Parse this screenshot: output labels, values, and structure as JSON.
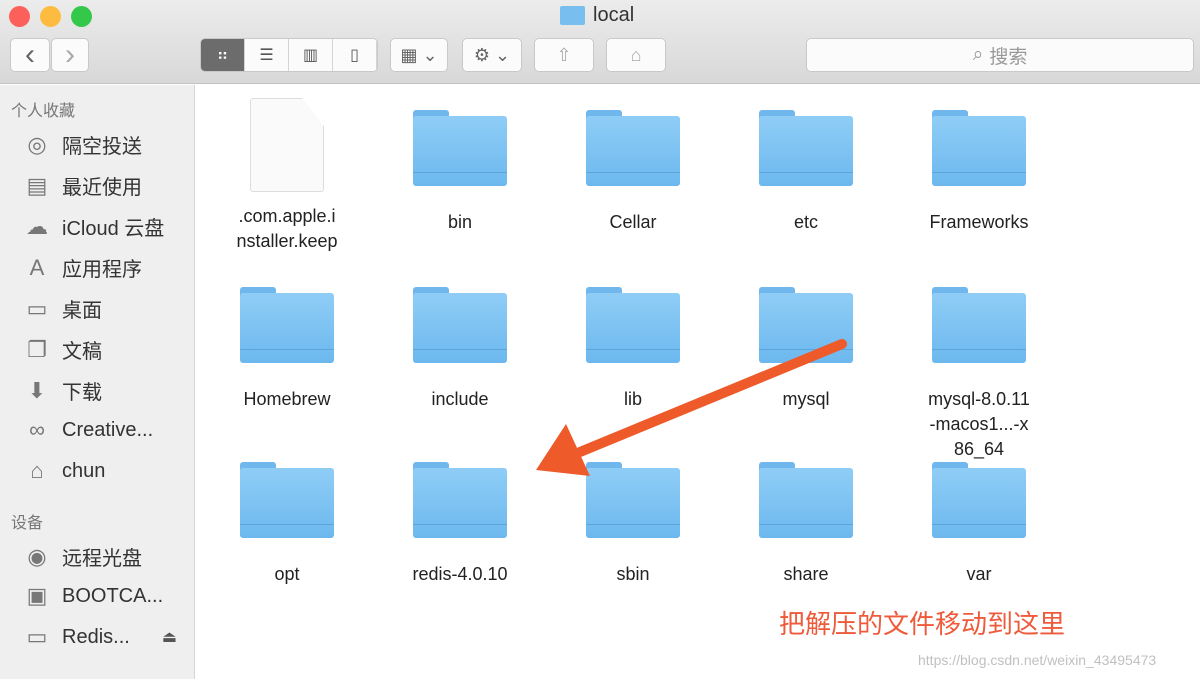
{
  "window": {
    "title": "local",
    "folder_icon": "folder-icon"
  },
  "toolbar": {
    "back": "‹",
    "forward": "›",
    "search_placeholder": "搜索"
  },
  "sidebar": {
    "favorites_header": "个人收藏",
    "favorites": [
      {
        "label": "隔空投送",
        "icon": "airdrop-icon",
        "glyph": "◎"
      },
      {
        "label": "最近使用",
        "icon": "recents-icon",
        "glyph": "▤"
      },
      {
        "label": "iCloud 云盘",
        "icon": "cloud-icon",
        "glyph": "☁"
      },
      {
        "label": "应用程序",
        "icon": "applications-icon",
        "glyph": "A"
      },
      {
        "label": "桌面",
        "icon": "desktop-icon",
        "glyph": "▭"
      },
      {
        "label": "文稿",
        "icon": "documents-icon",
        "glyph": "❐"
      },
      {
        "label": "下载",
        "icon": "download-icon",
        "glyph": "⬇"
      },
      {
        "label": "Creative...",
        "icon": "creative-cloud-icon",
        "glyph": "∞"
      },
      {
        "label": "chun",
        "icon": "home-icon",
        "glyph": "⌂"
      }
    ],
    "devices_header": "设备",
    "devices": [
      {
        "label": "远程光盘",
        "icon": "disc-icon",
        "glyph": "◉"
      },
      {
        "label": "BOOTCA...",
        "icon": "hard-drive-icon",
        "glyph": "▣"
      },
      {
        "label": "Redis...",
        "icon": "drive-icon",
        "glyph": "▭"
      }
    ],
    "eject": "⏏"
  },
  "files": [
    {
      "name": ".com.apple.installer.keep",
      "type": "document"
    },
    {
      "name": "bin",
      "type": "folder"
    },
    {
      "name": "Cellar",
      "type": "folder"
    },
    {
      "name": "etc",
      "type": "folder"
    },
    {
      "name": "Frameworks",
      "type": "folder"
    },
    {
      "name": "Homebrew",
      "type": "folder"
    },
    {
      "name": "include",
      "type": "folder"
    },
    {
      "name": "lib",
      "type": "folder"
    },
    {
      "name": "mysql",
      "type": "folder"
    },
    {
      "name": "mysql-8.0.11-macos1...-x86_64",
      "type": "folder"
    },
    {
      "name": "opt",
      "type": "folder"
    },
    {
      "name": "redis-4.0.10",
      "type": "folder"
    },
    {
      "name": "sbin",
      "type": "folder"
    },
    {
      "name": "share",
      "type": "folder"
    },
    {
      "name": "var",
      "type": "folder"
    }
  ],
  "annotation": {
    "text": "把解压的文件移动到这里",
    "color": "#ee5a3a"
  },
  "watermark": "https://blog.csdn.net/weixin_43495473"
}
